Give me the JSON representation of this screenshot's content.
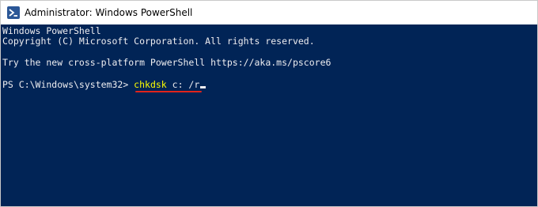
{
  "window": {
    "title": "Administrator: Windows PowerShell",
    "icon": "powershell-icon",
    "background_color": "#012456",
    "text_color": "#eeedf0"
  },
  "console": {
    "lines": [
      "Windows PowerShell",
      "Copyright (C) Microsoft Corporation. All rights reserved.",
      "Try the new cross-platform PowerShell https://aka.ms/pscore6"
    ],
    "prompt": "PS C:\\Windows\\system32> ",
    "command": "chkdsk",
    "command_color": "#ffff00",
    "arguments": " c: /r",
    "highlight_color": "#e1241b"
  }
}
